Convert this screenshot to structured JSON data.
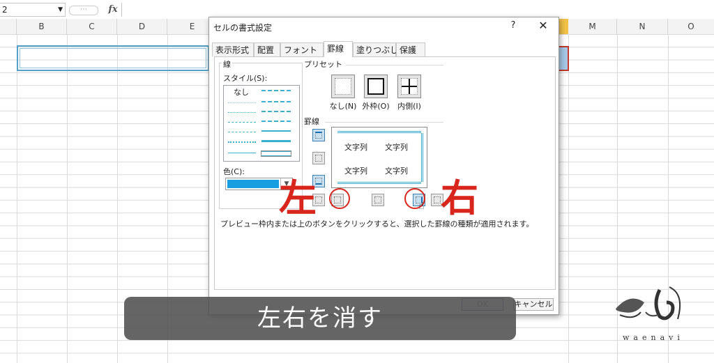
{
  "formula_bar": {
    "name_box": "2",
    "name_box_arrow": "▼",
    "fx": "fx",
    "dots": "⋯"
  },
  "columns": [
    "B",
    "C",
    "D",
    "E",
    "M",
    "N",
    "O"
  ],
  "dialog": {
    "title": "セルの書式設定",
    "help": "?",
    "close": "✕",
    "tabs": [
      "表示形式",
      "配置",
      "フォント",
      "罫線",
      "塗りつぶし",
      "保護"
    ],
    "active_tab": "罫線",
    "line_group": "線",
    "style_label": "スタイル(S):",
    "none_style": "なし",
    "color_label": "色(C):",
    "color_value": "#1a9ee2",
    "preset_group": "プリセット",
    "presets": [
      "なし(N)",
      "外枠(O)",
      "内側(I)"
    ],
    "border_group": "罫線",
    "preview_text": [
      "文字列",
      "文字列",
      "文字列",
      "文字列"
    ],
    "hint": "プレビュー枠内または上のボタンをクリックすると、選択した罫線の種類が適用されます。",
    "ok": "OK",
    "cancel": "キャンセル"
  },
  "annotations": {
    "left": "左",
    "right": "右",
    "accent": "#d8261c"
  },
  "caption": "左右を消す",
  "logo_text": "waenavi"
}
